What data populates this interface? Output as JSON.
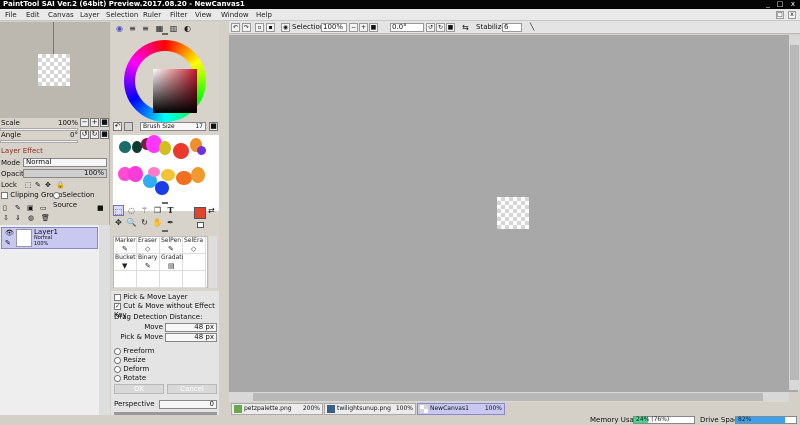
{
  "window": {
    "title": "PaintTool SAI Ver.2 (64bit) Preview.2017.08.20 - NewCanvas1",
    "minimize": "_",
    "restore": "□",
    "close": "x"
  },
  "menu": [
    "File",
    "Edit",
    "Canvas",
    "Layer",
    "Selection",
    "Ruler",
    "Filter",
    "View",
    "Window",
    "Help"
  ],
  "navigator": {
    "scale_label": "Scale",
    "scale_value": "100%",
    "angle_label": "Angle",
    "angle_value": "0°"
  },
  "layer_effect": {
    "header": "Layer Effect",
    "mode_label": "Mode",
    "mode_value": "Normal",
    "opacity_label": "Opacity",
    "opacity_value": "100%",
    "lock_label": "Lock",
    "clipping_group": "Clipping Group",
    "selection_source": "Selection Source"
  },
  "layers": [
    {
      "name": "Layer1",
      "mode": "Normal",
      "opacity": "100%"
    }
  ],
  "brush_size": {
    "label": "Brush Size",
    "value": "17"
  },
  "color": {
    "hue_hex": "#c4182a"
  },
  "brushes": [
    {
      "label": "Marker",
      "icon": "✎"
    },
    {
      "label": "Eraser",
      "icon": "◇"
    },
    {
      "label": "SelPen",
      "icon": "✎"
    },
    {
      "label": "SelEra",
      "icon": "◇"
    },
    {
      "label": "Bucket",
      "icon": "▼"
    },
    {
      "label": "Binary",
      "icon": "✎"
    },
    {
      "label": "Gradati",
      "icon": "▤"
    },
    {
      "label": "",
      "icon": ""
    }
  ],
  "tool_options": {
    "pick_move_layer": "Pick & Move Layer",
    "cut_move": "Cut & Move without Effect Key",
    "drag_detection": "Drag Detection Distance:",
    "move_label": "Move",
    "move_value": "48 px",
    "pick_move_label": "Pick & Move",
    "pick_move_value": "48 px",
    "transforms": [
      "Freeform",
      "Resize",
      "Deform",
      "Rotate"
    ],
    "ok": "OK",
    "cancel": "Cancel",
    "perspective_label": "Perspective",
    "perspective_value": "0"
  },
  "toolbar": {
    "selection_label": "Selection",
    "zoom_value": "100%",
    "angle_value": "0.0°",
    "stabilizer_label": "Stabilizer",
    "stabilizer_value": "6"
  },
  "tabs": [
    {
      "name": "petzpalette.png",
      "zoom": "200%"
    },
    {
      "name": "twilightsunup.png",
      "zoom": "100%"
    },
    {
      "name": "NewCanvas1",
      "zoom": "100%"
    }
  ],
  "status": {
    "memory_label": "Memory Usage",
    "memory_value": "24% (76%)",
    "memory_fraction": 0.24,
    "drive_label": "Drive Space",
    "drive_value": "82%",
    "drive_fraction": 0.82,
    "memory_color": "#44d68e",
    "drive_color": "#3aa0f0"
  }
}
